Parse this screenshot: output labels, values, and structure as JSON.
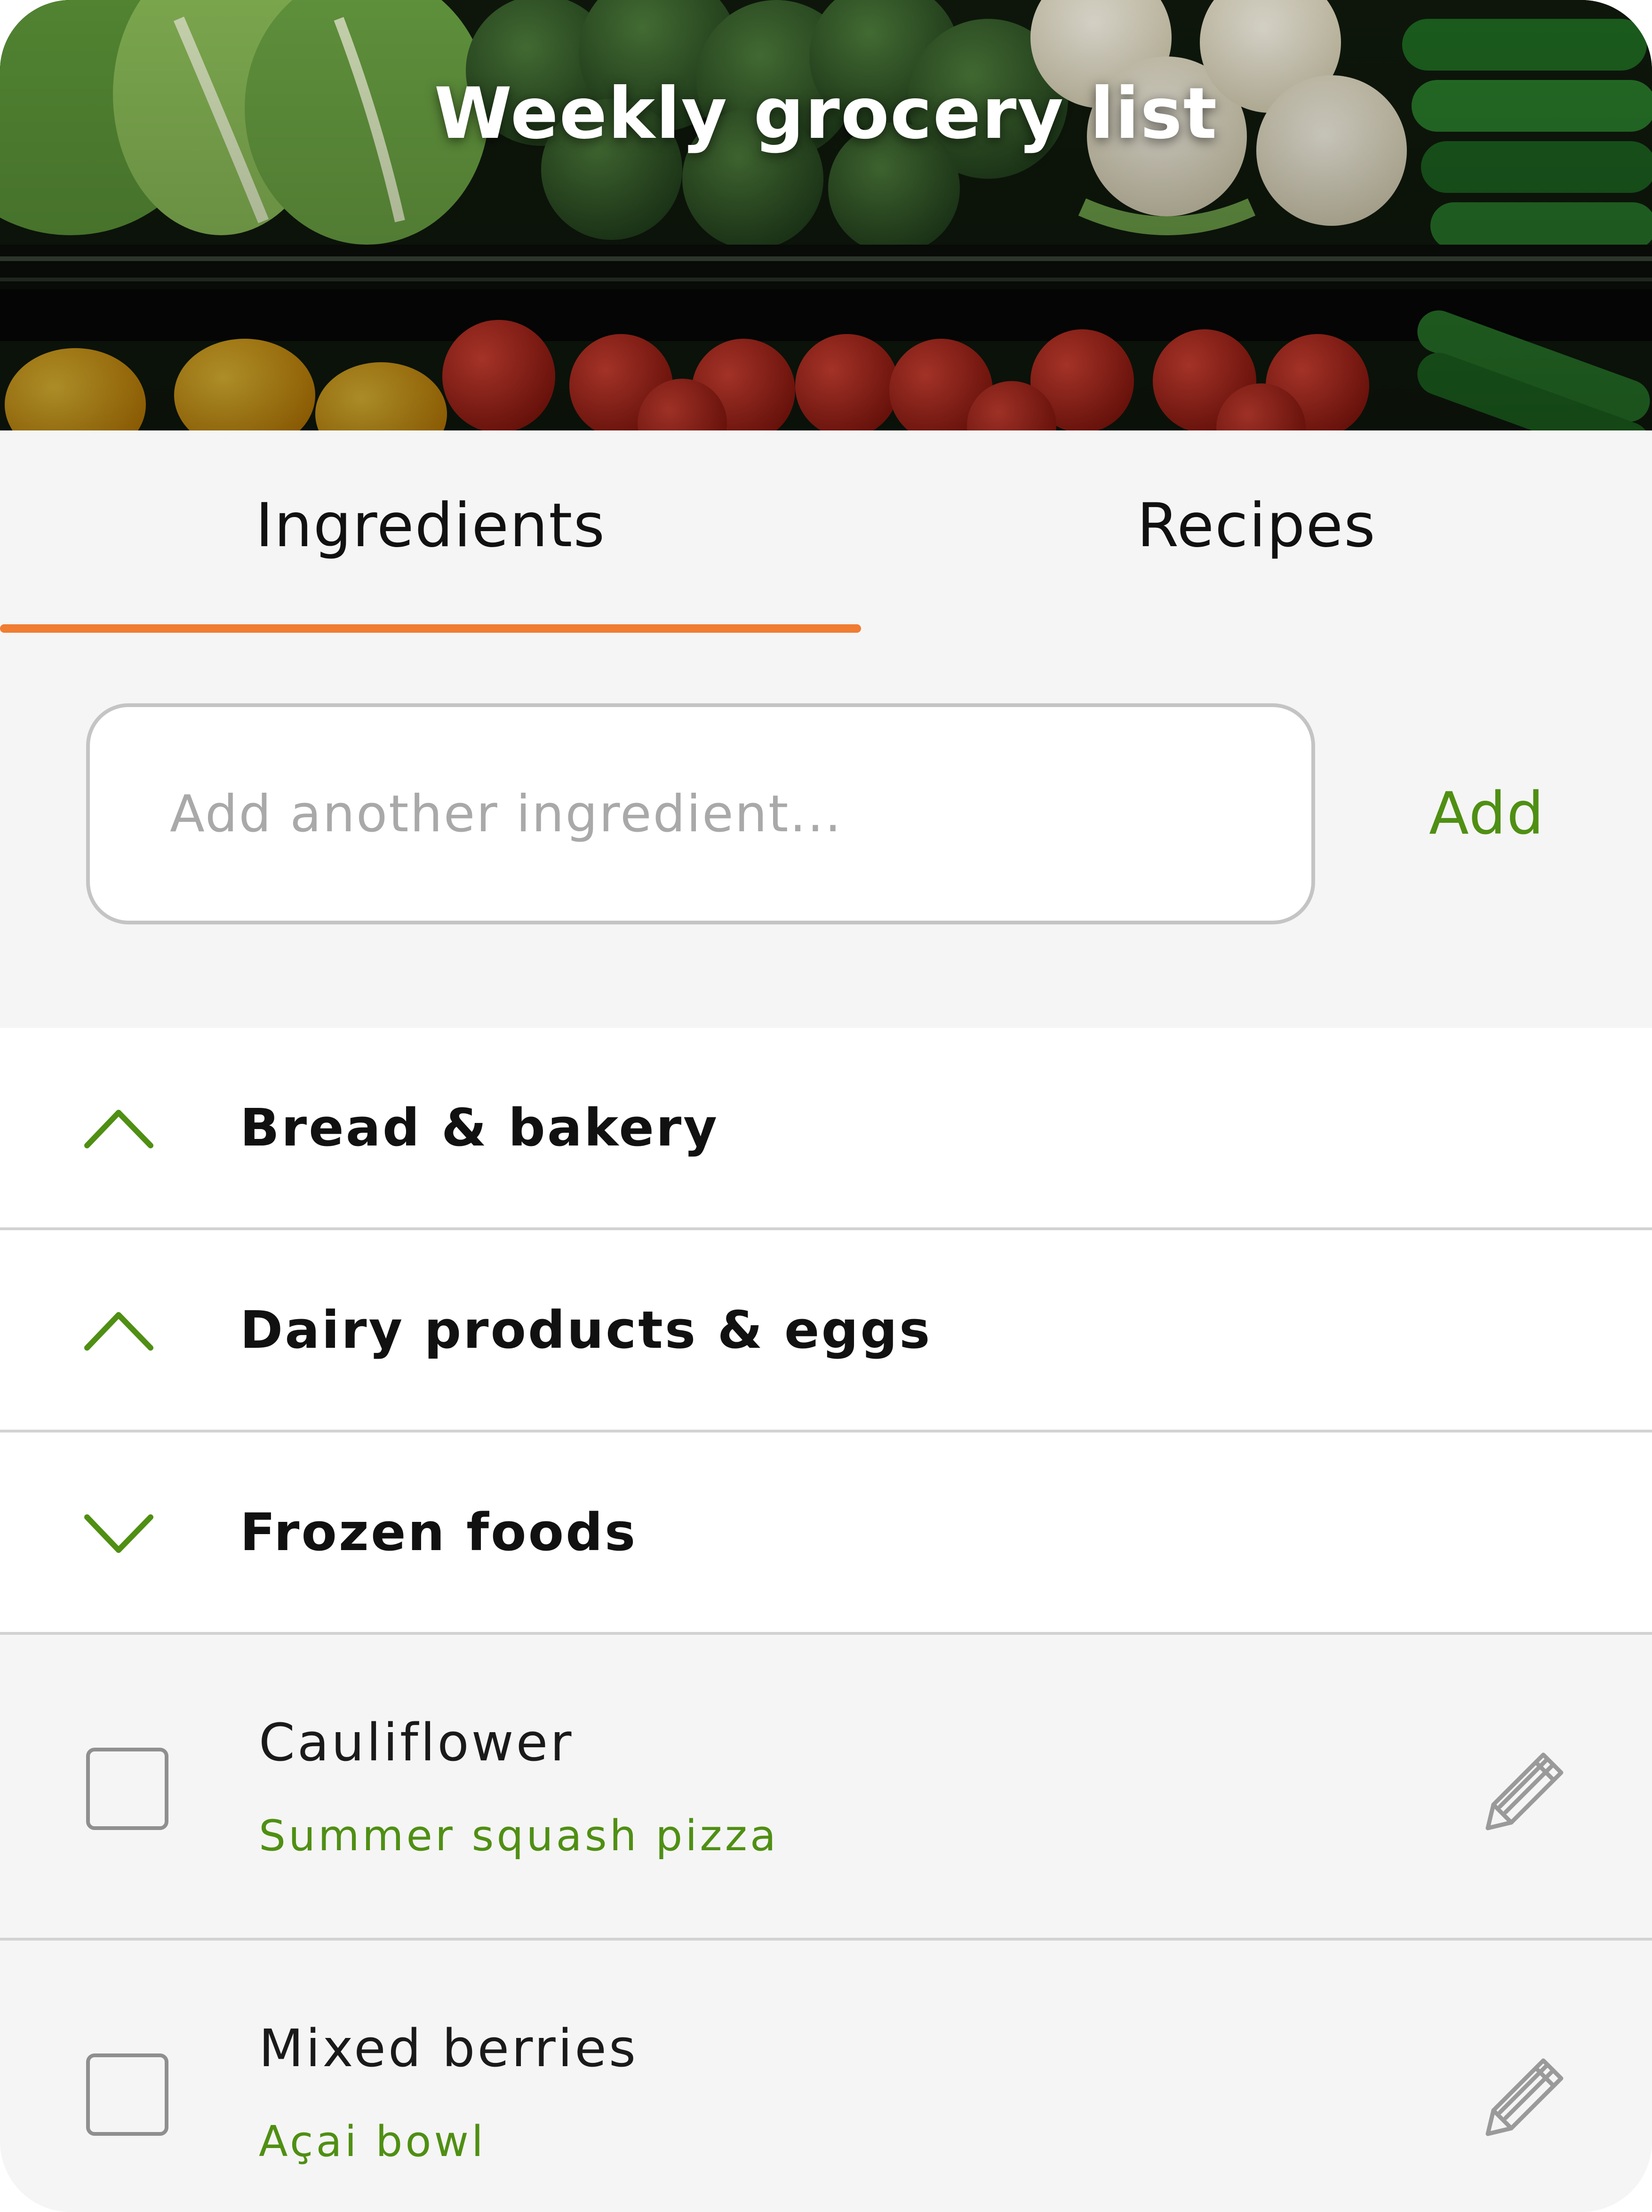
{
  "header": {
    "title": "Weekly grocery list"
  },
  "tabs": [
    {
      "label": "Ingredients",
      "active": true
    },
    {
      "label": "Recipes",
      "active": false
    }
  ],
  "add_ingredient": {
    "placeholder": "Add another ingredient...",
    "button_label": "Add"
  },
  "categories": [
    {
      "label": "Bread & bakery",
      "icon": "chevron-up-icon"
    },
    {
      "label": "Dairy products & eggs",
      "icon": "chevron-up-icon"
    },
    {
      "label": "Frozen foods",
      "icon": "chevron-down-icon"
    }
  ],
  "items": [
    {
      "name": "Cauliflower",
      "recipe": "Summer squash pizza",
      "checked": false,
      "icon": "pencil-icon"
    },
    {
      "name": "Mixed berries",
      "recipe": "Açai bowl",
      "checked": false,
      "icon": "pencil-icon"
    }
  ],
  "colors": {
    "accent_orange": "#f07d32",
    "accent_green": "#4f8f13",
    "background": "#f5f5f5",
    "divider": "#d2d2d2"
  }
}
